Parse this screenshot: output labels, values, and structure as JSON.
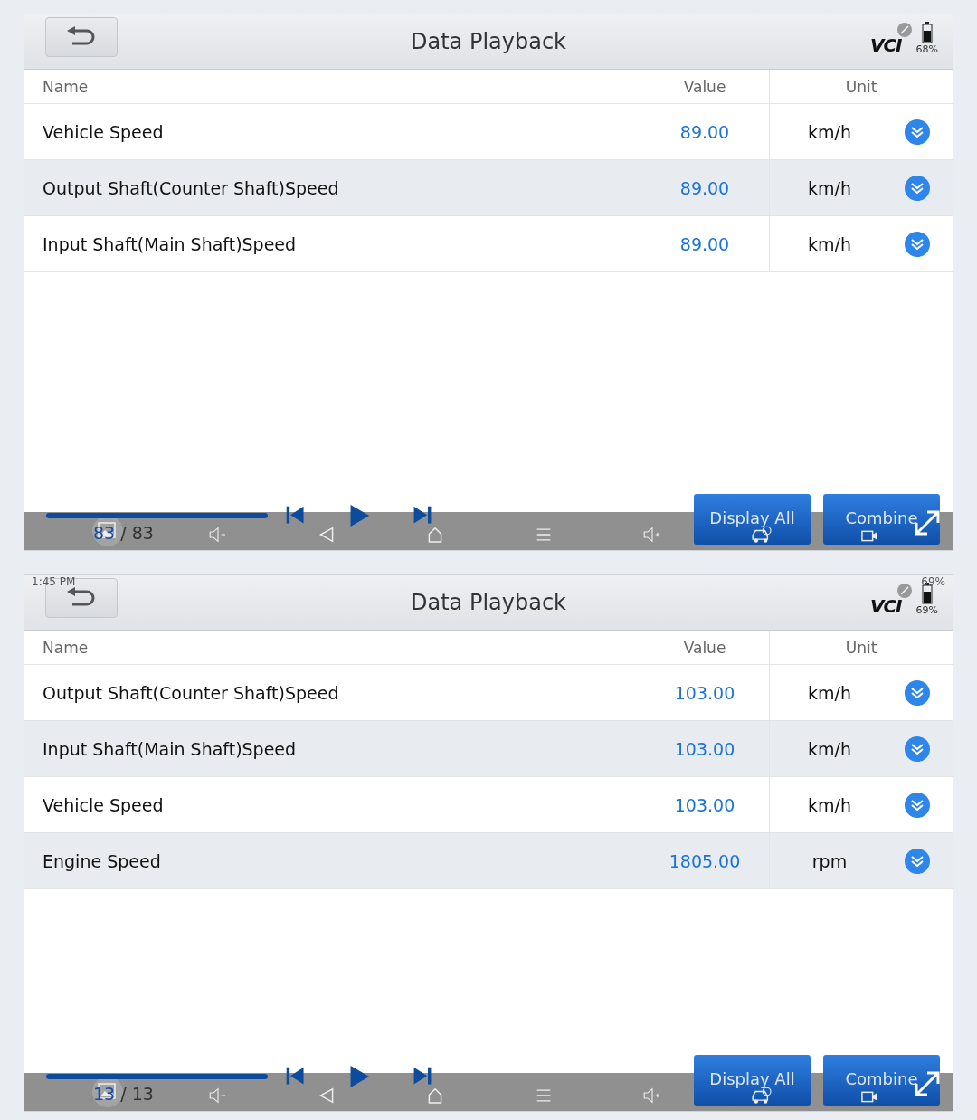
{
  "screens": [
    {
      "header": {
        "title": "Data Playback",
        "logo": "VCI",
        "battery": "68%"
      },
      "columns": [
        "Name",
        "Value",
        "Unit"
      ],
      "rows": [
        {
          "name": "Vehicle Speed",
          "value": "89.00",
          "unit": "km/h"
        },
        {
          "name": "Output Shaft(Counter Shaft)Speed",
          "value": "89.00",
          "unit": "km/h"
        },
        {
          "name": "Input Shaft(Main Shaft)Speed",
          "value": "89.00",
          "unit": "km/h"
        }
      ],
      "playback": {
        "level": 1,
        "current": "83",
        "total": "/ 83",
        "buttons": [
          "Display All",
          "Combine"
        ]
      }
    },
    {
      "status_bar": {
        "time": "1:45 PM",
        "battery": "69%"
      },
      "header": {
        "title": "Data Playback",
        "logo": "VCI",
        "battery": "69%"
      },
      "columns": [
        "Name",
        "Value",
        "Unit"
      ],
      "rows": [
        {
          "name": "Output Shaft(Counter Shaft)Speed",
          "value": "103.00",
          "unit": "km/h"
        },
        {
          "name": "Input Shaft(Main Shaft)Speed",
          "value": "103.00",
          "unit": "km/h"
        },
        {
          "name": "Vehicle Speed",
          "value": "103.00",
          "unit": "km/h"
        },
        {
          "name": "Engine Speed",
          "value": "1805.00",
          "unit": "rpm"
        }
      ],
      "playback": {
        "level": 1,
        "current": "13",
        "total": "/ 13",
        "buttons": [
          "Display All",
          "Combine"
        ]
      }
    }
  ]
}
